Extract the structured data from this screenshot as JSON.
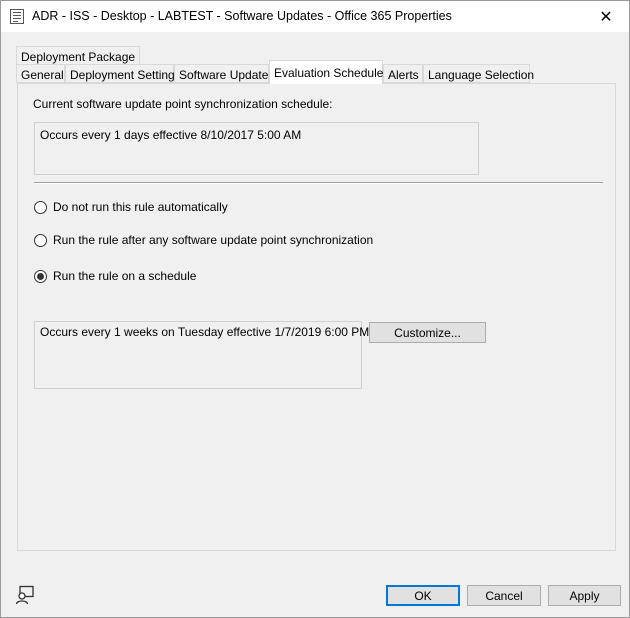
{
  "window": {
    "title": "ADR - ISS - Desktop - LABTEST - Software Updates - Office 365 Properties",
    "close_glyph": "✕"
  },
  "tabs": {
    "row1": [
      {
        "label": "Deployment Package"
      }
    ],
    "row2": [
      {
        "label": "General"
      },
      {
        "label": "Deployment Settings"
      },
      {
        "label": "Software Updates"
      },
      {
        "label": "Evaluation Schedule",
        "active": true
      },
      {
        "label": "Alerts"
      },
      {
        "label": "Language Selection"
      }
    ]
  },
  "panel": {
    "sync_label": "Current software update point synchronization schedule:",
    "sync_schedule": "Occurs every 1 days effective 8/10/2017 5:00 AM",
    "options": [
      {
        "label": "Do not run this rule automatically",
        "checked": false
      },
      {
        "label": "Run the rule after any software update point synchronization",
        "checked": false
      },
      {
        "label": "Run the rule on a schedule",
        "checked": true
      }
    ],
    "rule_schedule": "Occurs every 1 weeks on Tuesday effective 1/7/2019 6:00 PM",
    "customize_label": "Customize..."
  },
  "footer": {
    "ok_label": "OK",
    "cancel_label": "Cancel",
    "apply_label": "Apply"
  }
}
